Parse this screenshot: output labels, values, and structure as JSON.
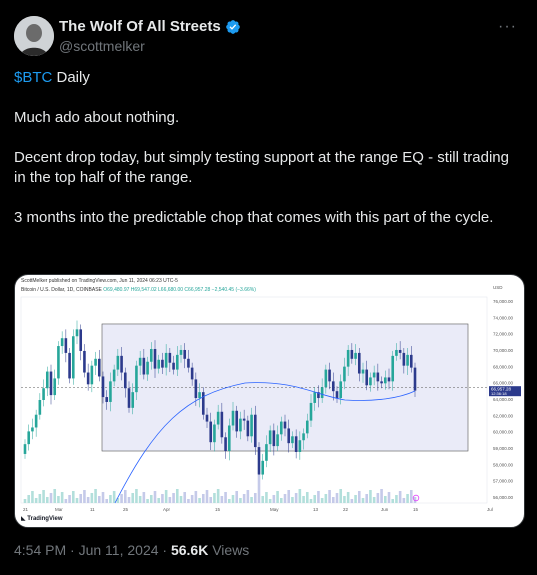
{
  "tweet": {
    "display_name": "The Wolf Of All Streets",
    "handle": "@scottmelker",
    "more_icon": "···",
    "cashtag": "$BTC",
    "line1_rest": " Daily",
    "para2": "Much ado about nothing.",
    "para3": "Decent drop today, but simply testing support at the range EQ - still trading in the top half of the range.",
    "para4": "3 months into the predictable chop that comes with this part of the cycle.",
    "time": "4:54 PM",
    "date": "Jun 11, 2024",
    "views_count": "56.6K",
    "views_label": " Views"
  },
  "chart_data": {
    "type": "candlestick",
    "header": "ScottMelker published on TradingView.com, Jun 11, 2024 06:23 UTC-5",
    "symbol_line": "Bitcoin / U.S. Dollar, 1D, COINBASE",
    "ohlc_line": "O69,480.97 H69,547.02 L66,680.00 C66,957.28 −2,540.45 (−3.66%)",
    "currency": "USD",
    "last_price": "66,957.28",
    "last_time": "12:36:18",
    "x_ticks": [
      "21",
      "Mar",
      "11",
      "25",
      "Apr",
      "15",
      "May",
      "13",
      "22",
      "Jun",
      "15",
      "Jul"
    ],
    "y_ticks": [
      "76,000.00",
      "74,000.00",
      "72,000.00",
      "70,000.00",
      "68,000.00",
      "66,000.00",
      "64,000.00",
      "62,000.00",
      "60,000.00",
      "59,000.00",
      "58,000.00",
      "57,000.00",
      "56,000.00"
    ],
    "range_box": {
      "high": 73750,
      "low": 60800
    },
    "range_eq": 67300,
    "brand": "TradingView",
    "colors": {
      "up": "#26a69a",
      "down": "#2c3a8c",
      "box": "#d8daf2",
      "ma": "#2962ff"
    }
  }
}
